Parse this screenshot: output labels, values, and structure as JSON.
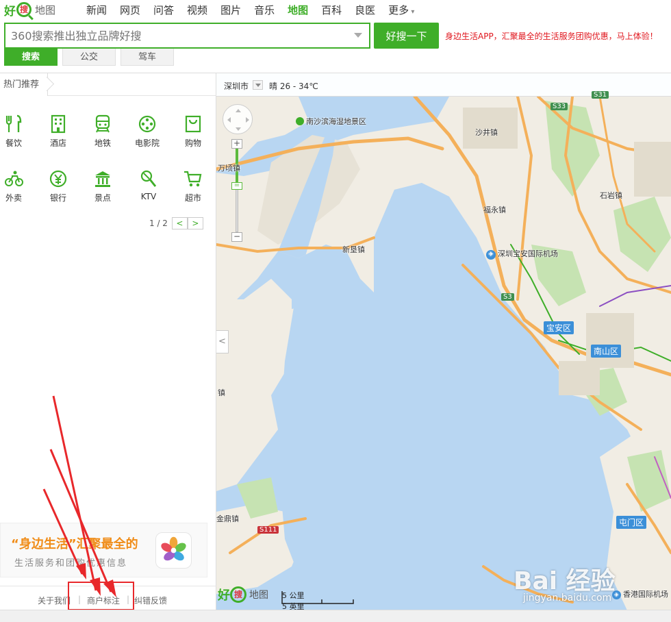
{
  "brand": {
    "hao": "好",
    "sou": "搜",
    "ditu": "地图"
  },
  "nav": [
    "新闻",
    "网页",
    "问答",
    "视频",
    "图片",
    "音乐",
    "地图",
    "百科",
    "良医",
    "更多"
  ],
  "search": {
    "placeholder": "360搜索推出独立品牌好搜",
    "button": "好搜一下",
    "promo": "身边生活APP，汇聚最全的生活服务团购优惠，马上体验！"
  },
  "modes": [
    "搜索",
    "公交",
    "驾车"
  ],
  "left": {
    "hot_label": "热门推荐",
    "categories": [
      {
        "label": "餐饮",
        "icon": "restaurant-icon"
      },
      {
        "label": "酒店",
        "icon": "hotel-icon"
      },
      {
        "label": "地铁",
        "icon": "subway-icon"
      },
      {
        "label": "电影院",
        "icon": "cinema-icon"
      },
      {
        "label": "购物",
        "icon": "shopping-bag-icon"
      },
      {
        "label": "外卖",
        "icon": "delivery-bike-icon"
      },
      {
        "label": "银行",
        "icon": "bank-yuan-icon"
      },
      {
        "label": "景点",
        "icon": "landmark-icon"
      },
      {
        "label": "KTV",
        "icon": "microphone-icon"
      },
      {
        "label": "超市",
        "icon": "shopping-cart-icon"
      }
    ],
    "pager": {
      "page": "1 / 2",
      "prev": "<",
      "next": ">"
    },
    "banner": {
      "line1": "“身边生活”汇聚最全的",
      "line2": "生活服务和团购优惠信息"
    },
    "footer": {
      "about": "关于我们",
      "merchant": "商户标注",
      "feedback": "纠错反馈",
      "sep": "|"
    }
  },
  "map": {
    "city": "深圳市",
    "weather": "晴 26 - 34℃",
    "labels": {
      "wetland": "南沙滨海湿地景区",
      "shajing": "沙井镇",
      "wanqing": "万顷镇",
      "shiyan": "石岩镇",
      "fuyong": "福永镇",
      "xinken": "新垦镇",
      "airport": "深圳宝安国际机场",
      "baoan": "宝安区",
      "nanshan": "南山区",
      "tuenmun": "屯门区",
      "jinding": "金鼎镇",
      "zhen_left": "镇",
      "hk_airport": "香港国际机场"
    },
    "roads": {
      "s33": "S33",
      "s31": "S31",
      "s3": "S3",
      "s111": "S111"
    },
    "scale_km": "5 公里",
    "scale_mi": "5 英里",
    "zoom_in": "+",
    "zoom_out": "−",
    "collapse": "<"
  },
  "watermark": {
    "text": "Bai 经验",
    "url": "jingyan.baidu.com"
  }
}
